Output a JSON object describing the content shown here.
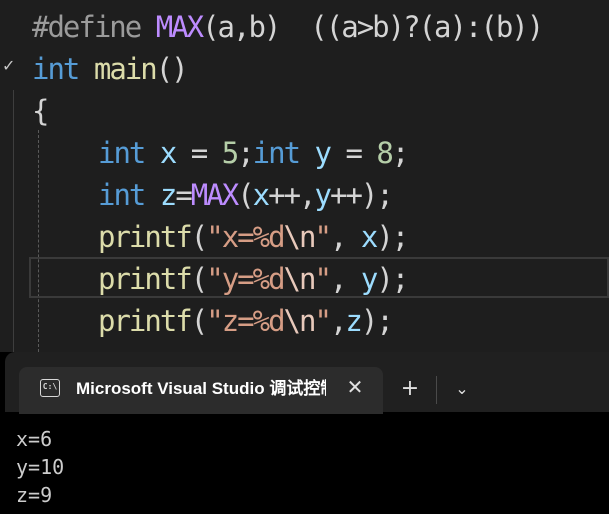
{
  "editor": {
    "line1": {
      "define": "#define",
      "macro": "MAX",
      "params": "(a,b)",
      "body": "  ((a>b)?(a):(b))"
    },
    "line2": {
      "kw": "int",
      "sp": " ",
      "fn": "main",
      "parens": "()"
    },
    "line3": {
      "brace": "{"
    },
    "line4": {
      "kw1": "int",
      "sp1": " ",
      "var1": "x",
      "eq1": " = ",
      "num1": "5",
      "semi1": ";",
      "kw2": "int",
      "sp2": " ",
      "var2": "y",
      "eq2": " = ",
      "num2": "8",
      "semi2": ";"
    },
    "line5": {
      "kw": "int",
      "sp": " ",
      "var": "z",
      "eq": "=",
      "macro": "MAX",
      "open": "(",
      "a1": "x",
      "inc1": "++,",
      "a2": "y",
      "inc2": "++",
      "close": ");"
    },
    "line6": {
      "fn": "printf",
      "open": "(",
      "str": "\"x=%d",
      "esc": "\\n",
      "strend": "\"",
      "comma": ", ",
      "arg": "x",
      "close": ");"
    },
    "line7": {
      "fn": "printf",
      "open": "(",
      "str": "\"y=%d",
      "esc": "\\n",
      "strend": "\"",
      "comma": ", ",
      "arg": "y",
      "close": ");"
    },
    "line8": {
      "fn": "printf",
      "open": "(",
      "str": "\"z=%d",
      "esc": "\\n",
      "strend": "\"",
      "comma": ",",
      "arg": "z",
      "close": ");"
    },
    "collapse_marker": "✓"
  },
  "terminal": {
    "tab_icon_text": "C:\\",
    "tab_title": "Microsoft Visual Studio 调试控制台",
    "close_glyph": "✕",
    "new_tab_glyph": "+",
    "dropdown_glyph": "⌄",
    "output": [
      "x=6",
      "y=10",
      "z=9"
    ]
  },
  "colors": {
    "editor_bg": "#1e1e1e",
    "keyword": "#569cd6",
    "function": "#dcdcaa",
    "macro": "#bd8cff",
    "variable": "#9cdcfe",
    "number": "#b5cea8",
    "string": "#d69d85",
    "terminal_bg": "#000000",
    "tabstrip_bg": "#202020"
  }
}
